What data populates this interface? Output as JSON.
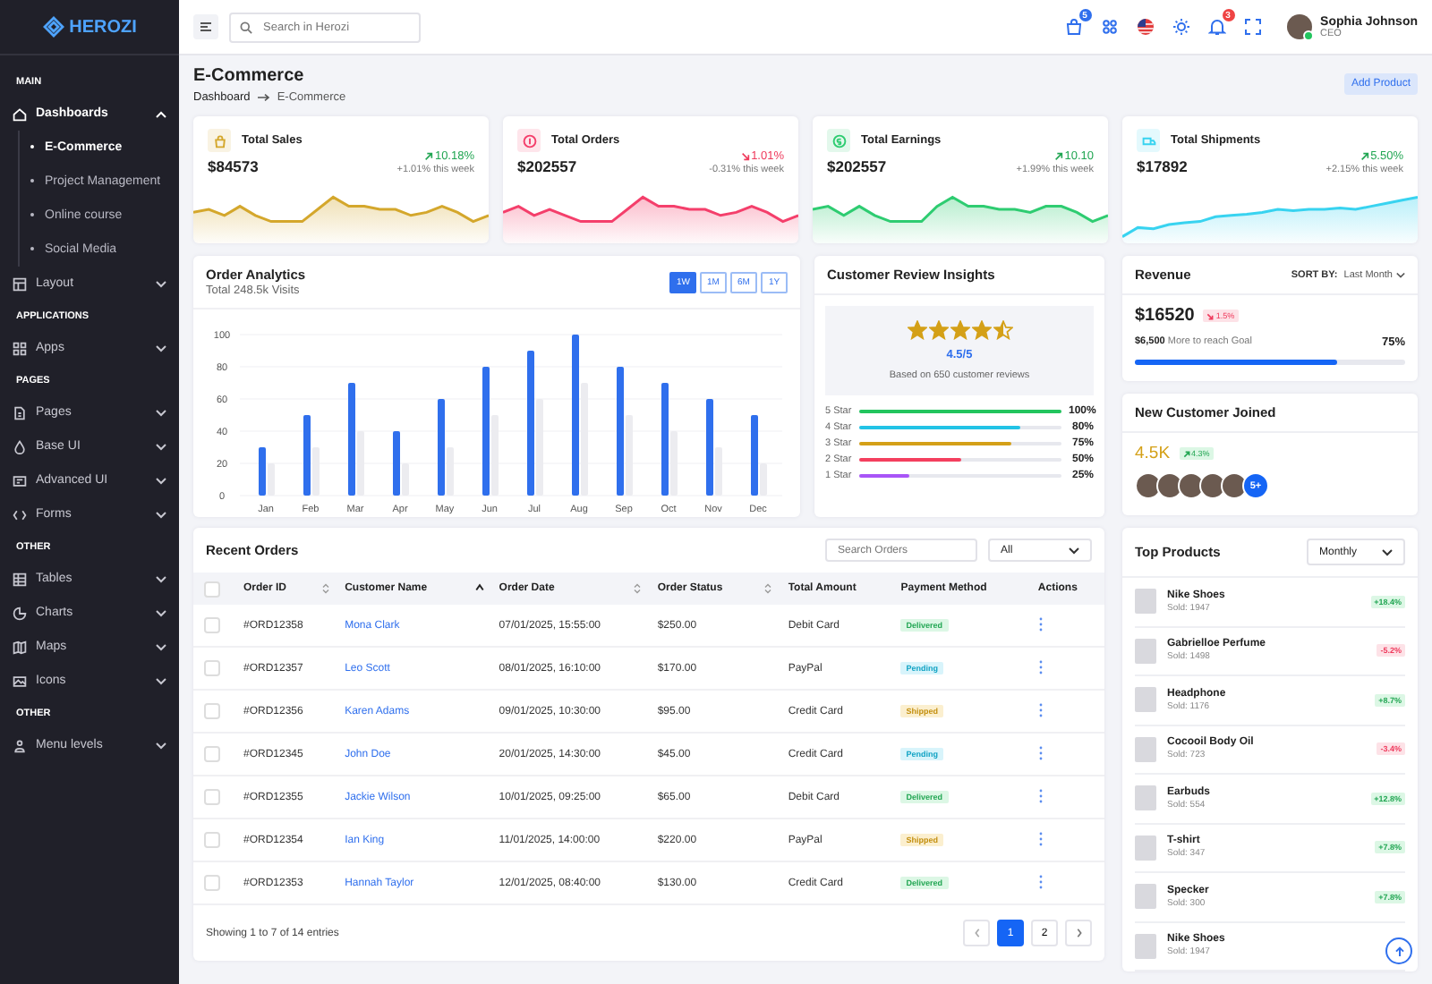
{
  "sidebar": {
    "logo": "HEROZI",
    "entries": [
      {
        "kind": "heading",
        "label": "MAIN"
      },
      {
        "kind": "item",
        "label": "Dashboards",
        "expanded": true,
        "children": [
          {
            "label": "E-Commerce",
            "selected": true
          },
          {
            "label": "Project Management",
            "selected": false
          },
          {
            "label": "Online course",
            "selected": false
          },
          {
            "label": "Social Media",
            "selected": false
          }
        ]
      },
      {
        "kind": "item",
        "label": "Layout",
        "expanded": false
      },
      {
        "kind": "heading",
        "label": "APPLICATIONS"
      },
      {
        "kind": "item",
        "label": "Apps",
        "expanded": false
      },
      {
        "kind": "heading",
        "label": "PAGES"
      },
      {
        "kind": "item",
        "label": "Pages",
        "expanded": false
      },
      {
        "kind": "item",
        "label": "Base UI",
        "expanded": false
      },
      {
        "kind": "item",
        "label": "Advanced UI",
        "expanded": false
      },
      {
        "kind": "item",
        "label": "Forms",
        "expanded": false
      },
      {
        "kind": "heading",
        "label": "OTHER"
      },
      {
        "kind": "item",
        "label": "Tables",
        "expanded": false
      },
      {
        "kind": "item",
        "label": "Charts",
        "expanded": false
      },
      {
        "kind": "item",
        "label": "Maps",
        "expanded": false
      },
      {
        "kind": "item",
        "label": "Icons",
        "expanded": false
      },
      {
        "kind": "heading",
        "label": "OTHER"
      },
      {
        "kind": "item",
        "label": "Menu levels",
        "expanded": false
      }
    ]
  },
  "header": {
    "search": {
      "placeholder": "Search in Herozi"
    },
    "cart_badge": "5",
    "notification_badge": "3",
    "user": {
      "name": "Sophia Johnson",
      "role": "CEO",
      "online": true
    }
  },
  "page": {
    "title": "E-Commerce",
    "breadcrumb": [
      "Dashboard",
      "E-Commerce"
    ],
    "action": "Add Product"
  },
  "stats": [
    {
      "title": "Total Sales",
      "value": "$84573",
      "change": "10.18%",
      "negative": false,
      "note": "+1.01% this week",
      "color": "#d4a72c"
    },
    {
      "title": "Total Orders",
      "value": "$202557",
      "change": "1.01%",
      "negative": true,
      "note": "-0.31% this week",
      "color": "#f43f6b"
    },
    {
      "title": "Total Earnings",
      "value": "$202557",
      "change": "10.10",
      "negative": false,
      "note": "+1.99% this week",
      "color": "#2ecc71"
    },
    {
      "title": "Total Shipments",
      "value": "$17892",
      "change": "5.50%",
      "negative": false,
      "note": "+2.15% this week",
      "color": "#38d3f0"
    }
  ],
  "analytics": {
    "title": "Order Analytics",
    "subtitle": "Total 248.5k Visits",
    "ranges": [
      {
        "label": "1W",
        "selected": true
      },
      {
        "label": "1M",
        "selected": false
      },
      {
        "label": "6M",
        "selected": false
      },
      {
        "label": "1Y",
        "selected": false
      }
    ],
    "chart_data": {
      "type": "bar",
      "categories": [
        "Jan",
        "Feb",
        "Mar",
        "Apr",
        "May",
        "Jun",
        "Jul",
        "Aug",
        "Sep",
        "Oct",
        "Nov",
        "Dec"
      ],
      "series": [
        {
          "color": "#2f6fed",
          "values": [
            30,
            50,
            70,
            40,
            60,
            80,
            90,
            100,
            80,
            70,
            60,
            50
          ]
        },
        {
          "color": "#ececf0",
          "values": [
            20,
            30,
            40,
            20,
            30,
            50,
            60,
            70,
            50,
            40,
            30,
            20
          ]
        }
      ],
      "ylim": [
        0,
        100
      ],
      "yticks": [
        0,
        20,
        40,
        60,
        80,
        100
      ],
      "grid": true
    }
  },
  "review": {
    "title": "Customer Review Insights",
    "stars": 4.5,
    "rating": "4.5/5",
    "note": "Based on 650 customer reviews",
    "breakdown": [
      {
        "label": "5 Star",
        "level": 1,
        "percent": "100%",
        "color": "#22c55e"
      },
      {
        "label": "4 Star",
        "level": 0.8,
        "percent": "80%",
        "color": "#22c3e6"
      },
      {
        "label": "3 Star",
        "level": 0.75,
        "percent": "75%",
        "color": "#d4a017"
      },
      {
        "label": "2 Star",
        "level": 0.5,
        "percent": "50%",
        "color": "#f43f5e"
      },
      {
        "label": "1 Star",
        "level": 0.25,
        "percent": "25%",
        "color": "#a855f7"
      }
    ]
  },
  "revenue": {
    "title": "Revenue",
    "sort_label": "SORT BY:",
    "sort_value": "Last Month",
    "amount": "$16520",
    "change": "1.5%",
    "negative": true,
    "goal_amount": "$6,500",
    "goal_text": "More to reach Goal",
    "percent": "75%",
    "level": 0.75
  },
  "new_customers": {
    "title": "New Customer Joined",
    "count": "4.5K",
    "change": "4.3%",
    "negative": false,
    "more": "5+"
  },
  "orders": {
    "title": "Recent Orders",
    "search": {
      "placeholder": "Search Orders"
    },
    "filter": "All",
    "all_checked": false,
    "columns": [
      {
        "label": "Order ID",
        "sortable": true,
        "sorted": false
      },
      {
        "label": "Customer Name",
        "sortable": true,
        "sorted": true
      },
      {
        "label": "Order Date",
        "sortable": true,
        "sorted": false
      },
      {
        "label": "Order Status",
        "sortable": true,
        "sorted": false
      },
      {
        "label": "Total Amount"
      },
      {
        "label": "Payment Method"
      },
      {
        "label": "Actions"
      }
    ],
    "rows": [
      {
        "checked": false,
        "id": "#ORD12358",
        "customer": "Mona Clark",
        "date": "07/01/2025, 15:55:00",
        "amount": "$250.00",
        "method": "Debit Card",
        "status": {
          "label": "Delivered",
          "kind": "delivered"
        }
      },
      {
        "checked": false,
        "id": "#ORD12357",
        "customer": "Leo Scott",
        "date": "08/01/2025, 16:10:00",
        "amount": "$170.00",
        "method": "PayPal",
        "status": {
          "label": "Pending",
          "kind": "pending"
        }
      },
      {
        "checked": false,
        "id": "#ORD12356",
        "customer": "Karen Adams",
        "date": "09/01/2025, 10:30:00",
        "amount": "$95.00",
        "method": "Credit Card",
        "status": {
          "label": "Shipped",
          "kind": "shipped"
        }
      },
      {
        "checked": false,
        "id": "#ORD12345",
        "customer": "John Doe",
        "date": "20/01/2025, 14:30:00",
        "amount": "$45.00",
        "method": "Credit Card",
        "status": {
          "label": "Pending",
          "kind": "pending"
        }
      },
      {
        "checked": false,
        "id": "#ORD12355",
        "customer": "Jackie Wilson",
        "date": "10/01/2025, 09:25:00",
        "amount": "$65.00",
        "method": "Debit Card",
        "status": {
          "label": "Delivered",
          "kind": "delivered"
        }
      },
      {
        "checked": false,
        "id": "#ORD12354",
        "customer": "Ian King",
        "date": "11/01/2025, 14:00:00",
        "amount": "$220.00",
        "method": "PayPal",
        "status": {
          "label": "Shipped",
          "kind": "shipped"
        }
      },
      {
        "checked": false,
        "id": "#ORD12353",
        "customer": "Hannah Taylor",
        "date": "12/01/2025, 08:40:00",
        "amount": "$130.00",
        "method": "Credit Card",
        "status": {
          "label": "Delivered",
          "kind": "delivered"
        }
      }
    ],
    "footer": "Showing 1 to 7 of 14 entries",
    "pages": [
      {
        "label": "1",
        "selected": true
      },
      {
        "label": "2",
        "selected": false
      }
    ]
  },
  "top_products": {
    "title": "Top Products",
    "period": "Monthly",
    "items": [
      {
        "name": "Nike Shoes",
        "sold": "Sold: 1947",
        "change": "+18.4%",
        "negative": false
      },
      {
        "name": "Gabrielloe Perfume",
        "sold": "Sold: 1498",
        "change": "-5.2%",
        "negative": true
      },
      {
        "name": "Headphone",
        "sold": "Sold: 1176",
        "change": "+8.7%",
        "negative": false
      },
      {
        "name": "Cocooil Body Oil",
        "sold": "Sold: 723",
        "change": "-3.4%",
        "negative": true
      },
      {
        "name": "Earbuds",
        "sold": "Sold: 554",
        "change": "+12.8%",
        "negative": false
      },
      {
        "name": "T-shirt",
        "sold": "Sold: 347",
        "change": "+7.8%",
        "negative": false
      },
      {
        "name": "Specker",
        "sold": "Sold: 300",
        "change": "+7.8%",
        "negative": false
      },
      {
        "name": "Nike Shoes",
        "sold": "Sold: 1947"
      }
    ]
  }
}
